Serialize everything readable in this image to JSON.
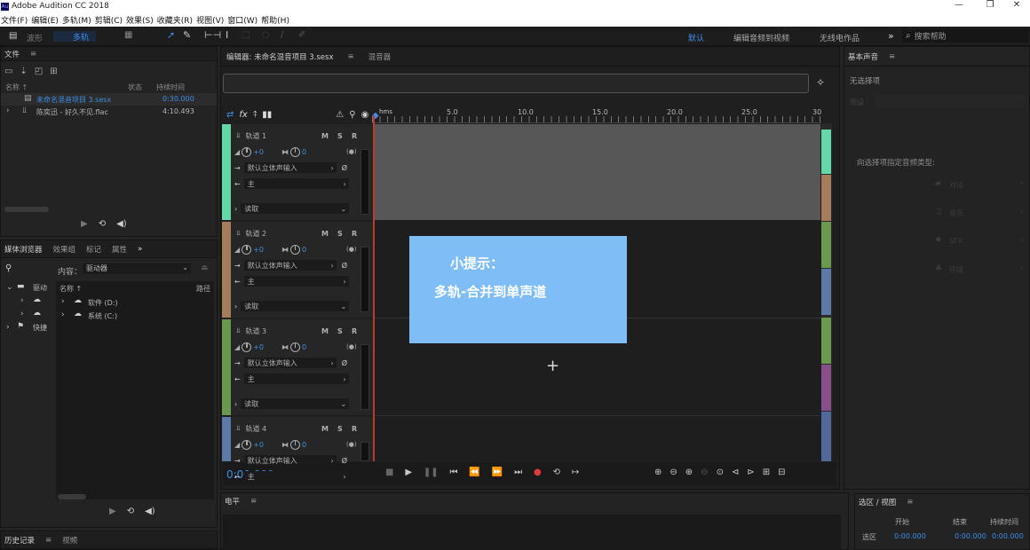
{
  "window": {
    "title": "Adobe Audition CC 2018",
    "icon": "Au"
  },
  "window_controls": [
    "—",
    "❐",
    "✕"
  ],
  "menu": [
    "文件(F)",
    "编辑(E)",
    "多轨(M)",
    "剪辑(C)",
    "效果(S)",
    "收藏夹(R)",
    "视图(V)",
    "窗口(W)",
    "帮助(H)"
  ],
  "toolbar": {
    "waveform": "波形",
    "multitrack": "多轨",
    "workspaces": [
      "默认",
      "编辑音频到视频",
      "无线电作品"
    ],
    "more": "»",
    "search_placeholder": "搜索帮助"
  },
  "files_panel": {
    "title": "文件",
    "columns": {
      "name": "名称 ↑",
      "status": "状态",
      "duration": "持续时间"
    },
    "items": [
      {
        "name": "未命名混音项目 3.sesx",
        "duration": "0:30.000",
        "selected": true
      },
      {
        "name": "陈奕迅 - 好久不见.flac",
        "duration": "4:10.493",
        "selected": false
      }
    ]
  },
  "media_browser": {
    "tabs": [
      "媒体浏览器",
      "效果组",
      "标记",
      "属性"
    ],
    "more": "»",
    "content_label": "内容：",
    "content_value": "驱动器",
    "tree": [
      "驱动",
      "快捷"
    ],
    "name_col": "名称 ↑",
    "path_col": "路径",
    "drives": [
      "软件 (D:)",
      "系统 (C:)"
    ]
  },
  "history": {
    "tabs": [
      "历史记录",
      "视频"
    ]
  },
  "editor": {
    "tab_editor": "编辑器: 未命名混音项目 3.sesx",
    "tab_mixer": "混音器",
    "time_unit": "hms",
    "ruler_ticks": [
      "5.0",
      "10.0",
      "15.0",
      "20.0",
      "25.0",
      "30"
    ],
    "timecode": "0:00.000",
    "menu_glyph": "≡"
  },
  "tracks": [
    {
      "name": "轨道 1",
      "volume": "+0",
      "pan": "0",
      "input": "默认立体声输入",
      "output": "主",
      "mode": "读取",
      "color": "#62d7a8"
    },
    {
      "name": "轨道 2",
      "volume": "+0",
      "pan": "0",
      "input": "默认立体声输入",
      "output": "主",
      "mode": "读取",
      "color": "#a57d5a"
    },
    {
      "name": "轨道 3",
      "volume": "+0",
      "pan": "0",
      "input": "默认立体声输入",
      "output": "主",
      "mode": "读取",
      "color": "#6a9a4e"
    },
    {
      "name": "轨道 4",
      "volume": "+0",
      "pan": "0",
      "input": "默认立体声输入",
      "output": "主",
      "mode": "读取",
      "color": "#5b7aa8"
    }
  ],
  "track_buttons": {
    "m": "M",
    "s": "S",
    "r": "R"
  },
  "tip_box": {
    "title": "小提示：",
    "body": "多轨-合并到单声道",
    "color": "#7fbdf7"
  },
  "essential_sound": {
    "title": "基本声音",
    "no_selection": "无选择项",
    "preset_label": "预设",
    "hint": "向选择项指定音频类型:",
    "types": [
      "对话",
      "音乐",
      "SFX",
      "环境"
    ]
  },
  "electrical_panel": {
    "title": "电平"
  },
  "selection_view": {
    "title": "选区 / 视图",
    "columns": [
      "开始",
      "结束",
      "持续时间"
    ],
    "rows": [
      {
        "label": "选区",
        "start": "0:00.000",
        "end": "0:00.000",
        "duration": "0:00.000"
      }
    ]
  },
  "colors": {
    "accent": "#3d8de6",
    "playhead": "#c0392b",
    "record": "#e03b3b"
  }
}
